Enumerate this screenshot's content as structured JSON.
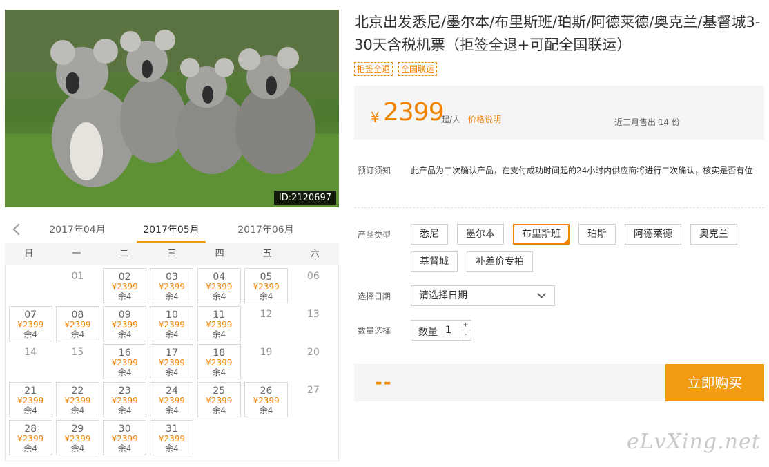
{
  "photo": {
    "id_label": "ID:2120697"
  },
  "calendar": {
    "months": [
      "2017年04月",
      "2017年05月",
      "2017年06月"
    ],
    "active_month_index": 1,
    "weekdays": [
      "日",
      "一",
      "二",
      "三",
      "四",
      "五",
      "六"
    ],
    "rows": [
      [
        {
          "d": ""
        },
        {
          "d": "01"
        },
        {
          "d": "02",
          "p": "¥2399",
          "s": "余4"
        },
        {
          "d": "03",
          "p": "¥2399",
          "s": "余4"
        },
        {
          "d": "04",
          "p": "¥2399",
          "s": "余4"
        },
        {
          "d": "05",
          "p": "¥2399",
          "s": "余4"
        },
        {
          "d": "06"
        }
      ],
      [
        {
          "d": "07",
          "p": "¥2399",
          "s": "余4"
        },
        {
          "d": "08",
          "p": "¥2399",
          "s": "余4"
        },
        {
          "d": "09",
          "p": "¥2399",
          "s": "余4"
        },
        {
          "d": "10",
          "p": "¥2399",
          "s": "余4"
        },
        {
          "d": "11",
          "p": "¥2399",
          "s": "余4"
        },
        {
          "d": "12"
        },
        {
          "d": "13"
        }
      ],
      [
        {
          "d": "14"
        },
        {
          "d": "15"
        },
        {
          "d": "16",
          "p": "¥2399",
          "s": "余4"
        },
        {
          "d": "17",
          "p": "¥2399",
          "s": "余4"
        },
        {
          "d": "18",
          "p": "¥2399",
          "s": "余4"
        },
        {
          "d": "19"
        },
        {
          "d": "20"
        }
      ],
      [
        {
          "d": "21",
          "p": "¥2399",
          "s": "余4"
        },
        {
          "d": "22",
          "p": "¥2399",
          "s": "余4"
        },
        {
          "d": "23",
          "p": "¥2399",
          "s": "余4"
        },
        {
          "d": "24",
          "p": "¥2399",
          "s": "余4"
        },
        {
          "d": "25",
          "p": "¥2399",
          "s": "余4"
        },
        {
          "d": "26",
          "p": "¥2399",
          "s": "余4"
        },
        {
          "d": "27"
        }
      ],
      [
        {
          "d": "28",
          "p": "¥2399",
          "s": "余4"
        },
        {
          "d": "29",
          "p": "¥2399",
          "s": "余4"
        },
        {
          "d": "30",
          "p": "¥2399",
          "s": "余4"
        },
        {
          "d": "31",
          "p": "¥2399",
          "s": "余4"
        },
        {
          "d": ""
        },
        {
          "d": ""
        },
        {
          "d": ""
        }
      ]
    ]
  },
  "product": {
    "title": "北京出发悉尼/墨尔本/布里斯班/珀斯/阿德莱德/奥克兰/基督城3-30天含税机票（拒签全退+可配全国联运）",
    "tags": [
      "拒签全退",
      "全国联运"
    ]
  },
  "price": {
    "currency": "¥",
    "amount": "2399",
    "unit": "起/人",
    "explain_link": "价格说明",
    "sold": "近三月售出 14 份"
  },
  "booking_notice": {
    "label": "预订须知",
    "text": "此产品为二次确认产品，在支付成功时间起的24小时内供应商将进行二次确认，核实是否有位"
  },
  "product_type": {
    "label": "产品类型",
    "options": [
      "悉尼",
      "墨尔本",
      "布里斯班",
      "珀斯",
      "阿德莱德",
      "奥克兰",
      "基督城",
      "补差价专拍"
    ],
    "selected_index": 2
  },
  "date_select": {
    "label": "选择日期",
    "placeholder": "请选择日期"
  },
  "quantity": {
    "label": "数量选择",
    "field_label": "数量",
    "value": "1",
    "plus": "+",
    "minus": "-"
  },
  "buy": {
    "total": "--",
    "button_label": "立即购买"
  },
  "watermark": "eLvXing.net",
  "colors": {
    "accent": "#f08300",
    "button": "#f39c12",
    "panel": "#f5f5f5"
  }
}
